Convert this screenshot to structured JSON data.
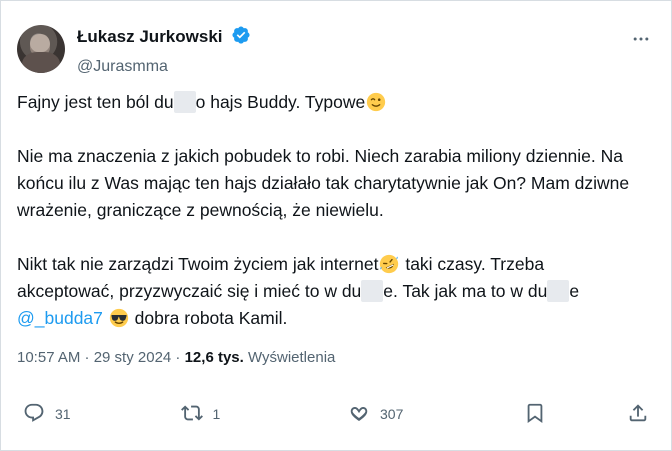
{
  "tweet": {
    "name": "Łukasz Jurkowski",
    "handle": "@Jurasmma",
    "paragraph1": {
      "before": "Fajny jest ten ból du",
      "after": "o hajs Buddy. Typowe"
    },
    "paragraph2": "Nie ma znaczenia z jakich pobudek to robi. Niech zarabia miliony dziennie. Na końcu ilu z Was mając ten hajs działało tak charytatywnie jak On? Mam dziwne wrażenie, graniczące z pewnością, że niewielu.",
    "paragraph3": {
      "line1": "Nikt tak nie zarządzi Twoim życiem jak internet",
      "line1b": " taki czasy. Trzeba",
      "line2": "akceptować, przyzwyczaić się i mieć to w du",
      "line2b": "e. Tak jak ma to w du",
      "line3_mention": "@_budda7",
      "line3_text": " dobra robota Kamil."
    },
    "meta": {
      "time": "10:57 AM · 29 sty 2024 · ",
      "views": "12,6 tys.",
      "views_label": " Wyświetlenia"
    },
    "actions": {
      "replies": "31",
      "reposts": "1",
      "likes": "307"
    }
  },
  "icons": {
    "verified": "verified-badge-icon",
    "more": "more-options-icon",
    "reply": "reply-icon",
    "repost": "repost-icon",
    "like": "heart-icon",
    "bookmark": "bookmark-icon",
    "share": "share-icon",
    "wink": "winking-face-emoji-icon",
    "laugh": "rolling-laughing-emoji-icon",
    "sunglasses": "sunglasses-face-emoji-icon"
  },
  "colors": {
    "text": "#0f1419",
    "secondary": "#536471",
    "accent": "#1d9bf0",
    "border": "#d7dde2"
  }
}
